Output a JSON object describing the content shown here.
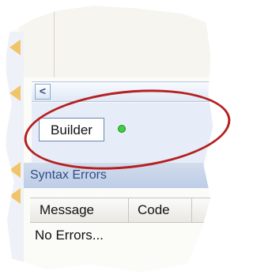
{
  "nav": {
    "back_glyph": "<"
  },
  "builder": {
    "label": "Builder",
    "status_icon": "green-dot-icon",
    "status_color": "#3ecf3e"
  },
  "highlight": {
    "color": "#b62020"
  },
  "syntax_errors": {
    "title": "Syntax Errors",
    "columns": [
      "Message",
      "Code"
    ],
    "empty_text": "No Errors..."
  }
}
